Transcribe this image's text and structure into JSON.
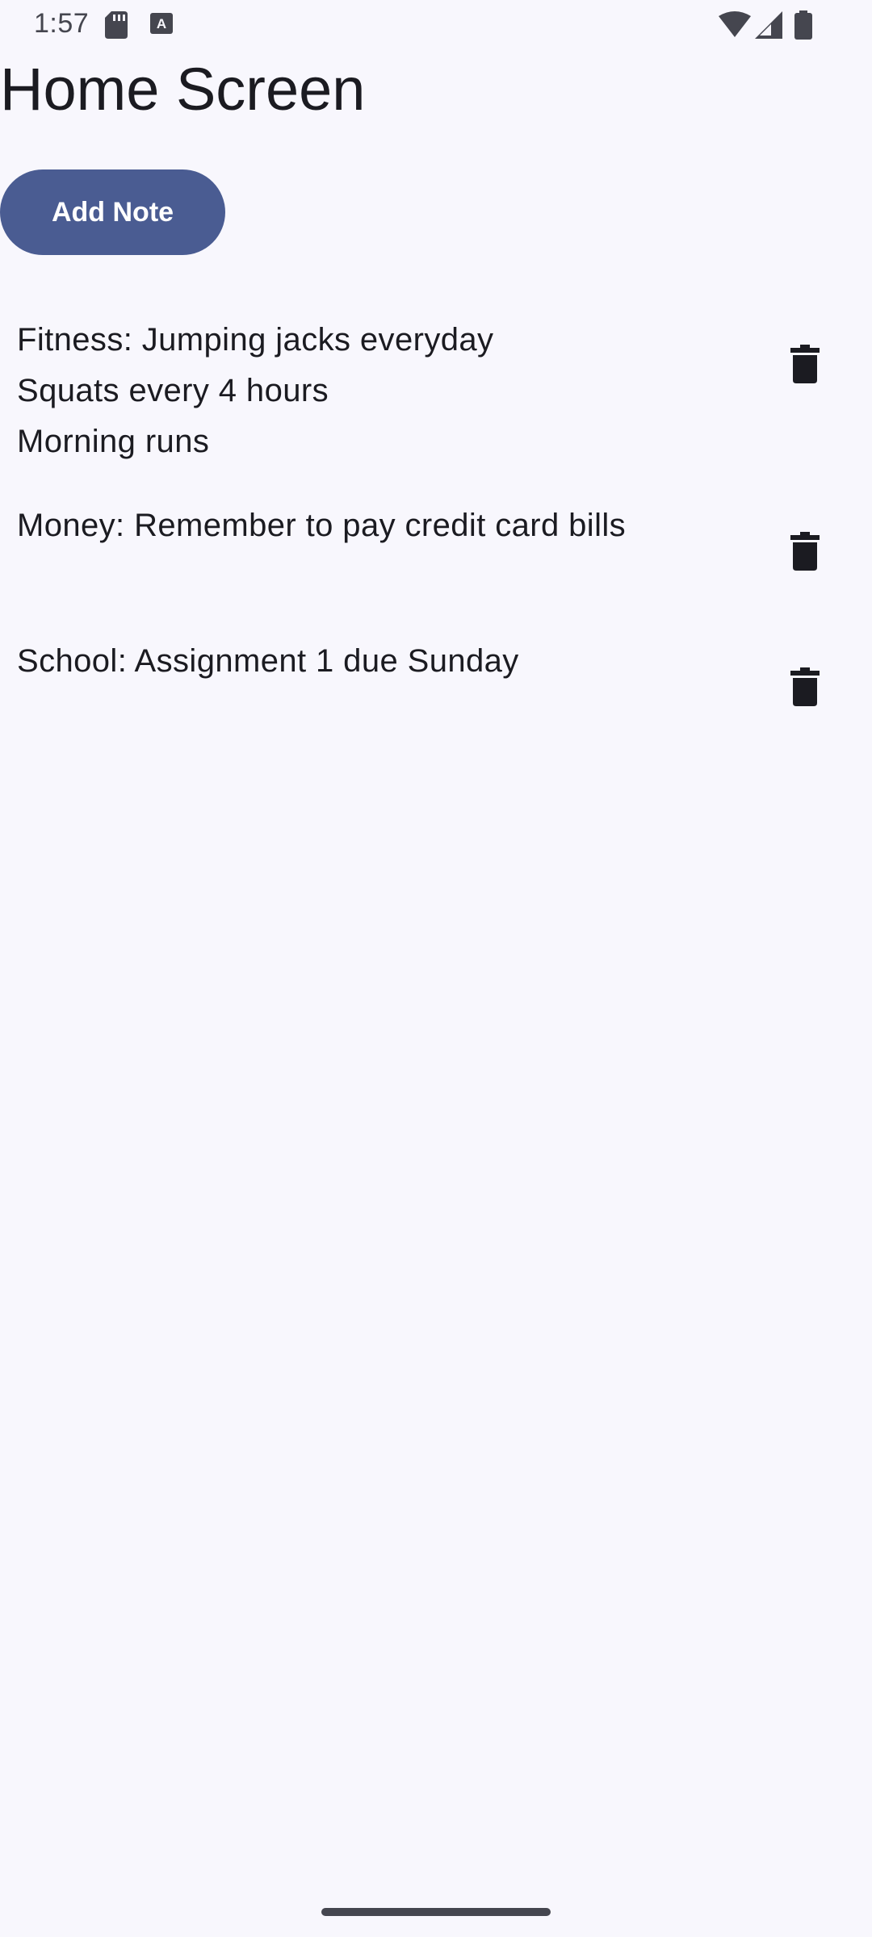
{
  "status_bar": {
    "time": "1:57",
    "icons": [
      "sd-card-icon",
      "keyboard-a-icon",
      "wifi-icon",
      "signal-icon",
      "battery-icon"
    ]
  },
  "page": {
    "title": "Home Screen"
  },
  "actions": {
    "add_note_label": "Add Note"
  },
  "notes": [
    {
      "text": "Fitness: Jumping jacks everyday\nSquats every 4 hours\nMorning runs",
      "delete_icon": "trash-icon"
    },
    {
      "text": "Money: Remember to pay credit card bills",
      "delete_icon": "trash-icon"
    },
    {
      "text": "School: Assignment 1 due Sunday",
      "delete_icon": "trash-icon"
    }
  ],
  "colors": {
    "background": "#f8f7fd",
    "primary": "#4a5c92",
    "on_primary": "#ffffff",
    "text": "#1b1b21"
  }
}
